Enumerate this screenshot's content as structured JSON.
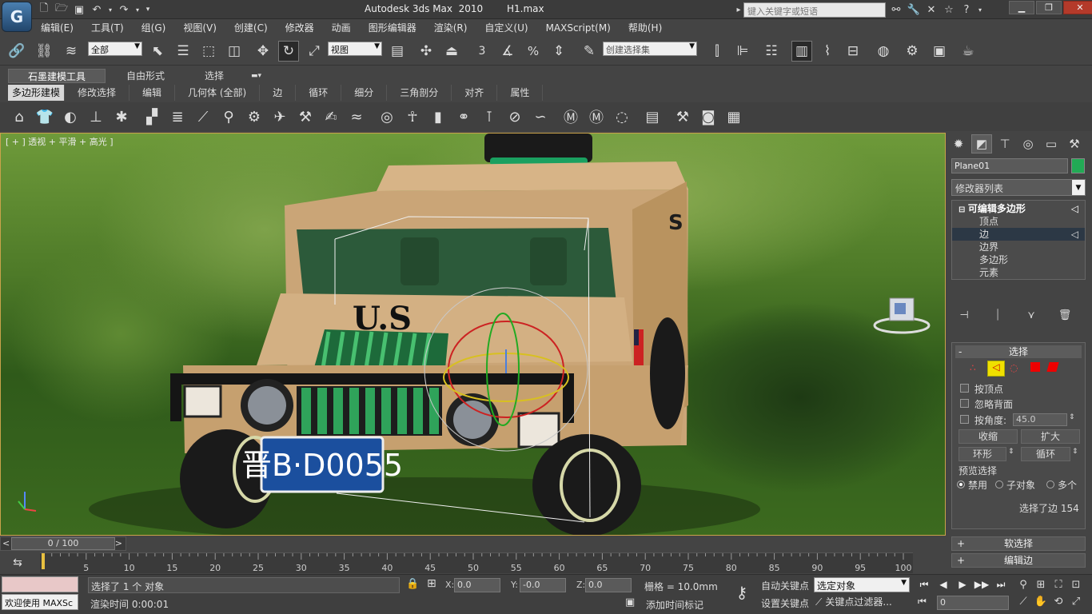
{
  "app": {
    "title": "Autodesk 3ds Max  2010",
    "file": "H1.max",
    "logo_glyph": "G"
  },
  "search": {
    "placeholder": "键入关键字或短语"
  },
  "menus": [
    "编辑(E)",
    "工具(T)",
    "组(G)",
    "视图(V)",
    "创建(C)",
    "修改器",
    "动画",
    "图形编辑器",
    "渲染(R)",
    "自定义(U)",
    "MAXScript(M)",
    "帮助(H)"
  ],
  "toolbar": {
    "selection_filter": "全部",
    "ref_coord": "视图",
    "named_sel": "创建选择集",
    "snap_labels": [
      "3",
      "%"
    ]
  },
  "ribbon": {
    "tabs": [
      "石墨建模工具",
      "自由形式",
      "选择"
    ],
    "active_tab": 0,
    "subtabs": [
      "多边形建模",
      "修改选择",
      "编辑",
      "几何体 (全部)",
      "边",
      "循环",
      "细分",
      "三角剖分",
      "对齐",
      "属性"
    ]
  },
  "viewport": {
    "label": "[ + ] 透视 + 平滑 + 高光 ]",
    "plate": "晋B·D0055",
    "hood_text": "U.S"
  },
  "panel": {
    "object_name": "Plane01",
    "object_color": "#22aa55",
    "modifier_list": "修改器列表",
    "stack": [
      {
        "label": "可编辑多边形",
        "level": 0
      },
      {
        "label": "顶点",
        "level": 1
      },
      {
        "label": "边",
        "level": 1
      },
      {
        "label": "边界",
        "level": 1
      },
      {
        "label": "多边形",
        "level": 1
      },
      {
        "label": "元素",
        "level": 1
      }
    ],
    "selected_stack_index": 2,
    "selection": {
      "title": "选择",
      "by_vertex": "按顶点",
      "ignore_backfacing": "忽略背面",
      "by_angle": "按角度:",
      "angle": "45.0",
      "shrink": "收缩",
      "grow": "扩大",
      "ring": "环形",
      "loop": "循环",
      "preview_title": "预览选择",
      "preview_off": "禁用",
      "preview_sub": "子对象",
      "preview_multi": "多个",
      "status": "选择了边 154"
    },
    "soft_selection": "软选择",
    "edit_edges": "编辑边"
  },
  "timeline": {
    "slider": "0 / 100",
    "ticks": [
      5,
      10,
      15,
      20,
      25,
      30,
      35,
      40,
      45,
      50,
      55,
      60,
      65,
      70,
      75,
      80,
      85,
      90,
      95,
      100
    ],
    "current": 0,
    "max": 100
  },
  "status": {
    "maxscript_text": "欢迎使用 MAXSc",
    "selected": "选择了 1 个 对象",
    "render_time": "渲染时间  0:00:01",
    "x": "0.0",
    "y": "-0.0",
    "z": "0.0",
    "grid": "栅格 = 10.0mm",
    "add_tag": "添加时间标记",
    "auto_key": "自动关键点",
    "set_key": "设置关键点",
    "sel_dropdown": "选定对象",
    "key_filter": "关键点过滤器...",
    "frame": "0"
  }
}
